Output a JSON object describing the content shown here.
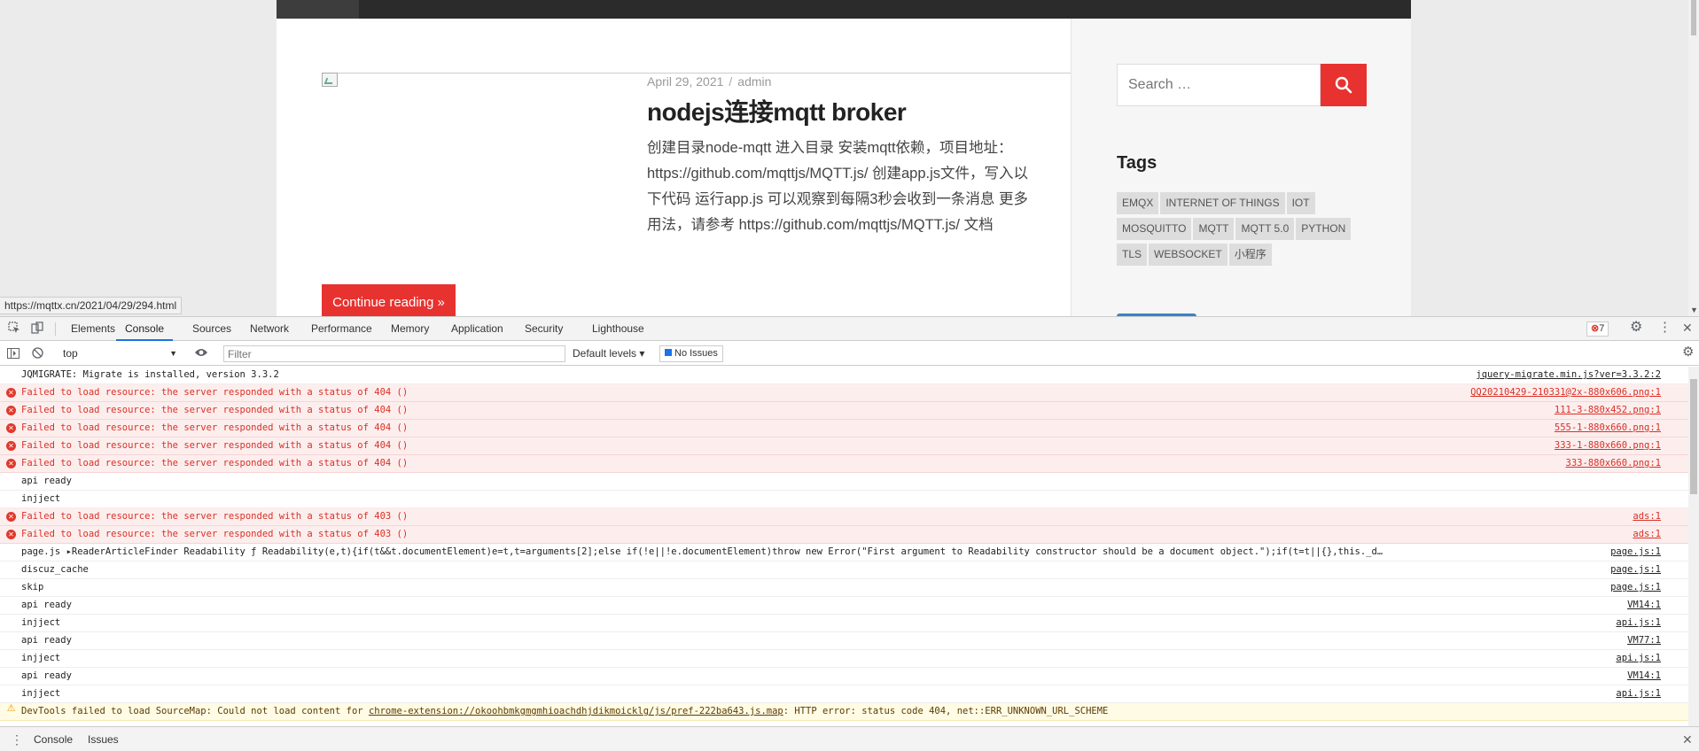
{
  "page": {
    "post": {
      "date": "April 29, 2021",
      "separator": "/",
      "author": "admin",
      "title": "nodejs连接mqtt broker",
      "excerpt": "创建目录node-mqtt 进入目录 安装mqtt依赖，项目地址：https://github.com/mqttjs/MQTT.js/ 创建app.js文件，写入以下代码 运行app.js 可以观察到每隔3秒会收到一条消息 更多用法，请参考 https://github.com/mqttjs/MQTT.js/ 文档",
      "continue_label": "Continue reading »"
    },
    "sidebar": {
      "search_placeholder": "Search …",
      "tags_title": "Tags",
      "tags": [
        "EMQX",
        "INTERNET OF THINGS",
        "IOT",
        "MOSQUITTO",
        "MQTT",
        "MQTT 5.0",
        "PYTHON",
        "TLS",
        "WEBSOCKET",
        "小程序"
      ]
    },
    "status_url": "https://mqttx.cn/2021/04/29/294.html"
  },
  "devtools": {
    "tabs": [
      "Elements",
      "Console",
      "Sources",
      "Network",
      "Performance",
      "Memory",
      "Application",
      "Security",
      "Lighthouse"
    ],
    "active_tab": "Console",
    "error_count": "7",
    "context": "top",
    "filter_placeholder": "Filter",
    "levels": "Default levels ▾",
    "issues": "No Issues",
    "messages": [
      {
        "level": "log",
        "text": "JQMIGRATE: Migrate is installed, version 3.3.2",
        "source": "jquery-migrate.min.js?ver=3.3.2:2"
      },
      {
        "level": "error",
        "text": "Failed to load resource: the server responded with a status of 404 ()",
        "source": "QQ20210429-210331@2x-880x606.png:1"
      },
      {
        "level": "error",
        "text": "Failed to load resource: the server responded with a status of 404 ()",
        "source": "111-3-880x452.png:1"
      },
      {
        "level": "error",
        "text": "Failed to load resource: the server responded with a status of 404 ()",
        "source": "555-1-880x660.png:1"
      },
      {
        "level": "error",
        "text": "Failed to load resource: the server responded with a status of 404 ()",
        "source": "333-1-880x660.png:1"
      },
      {
        "level": "error",
        "text": "Failed to load resource: the server responded with a status of 404 ()",
        "source": "333-880x660.png:1"
      },
      {
        "level": "log",
        "text": "api ready",
        "source": ""
      },
      {
        "level": "log",
        "text": "injject",
        "source": ""
      },
      {
        "level": "error",
        "text": "Failed to load resource: the server responded with a status of 403 ()",
        "source": "ads:1"
      },
      {
        "level": "error",
        "text": "Failed to load resource: the server responded with a status of 403 ()",
        "source": "ads:1"
      },
      {
        "level": "log",
        "text": "page.js ▸ReaderArticleFinder Readability ƒ Readability(e,t){if(t&&t.documentElement)e=t,t=arguments[2];else if(!e||!e.documentElement)throw new Error(\"First argument to Readability constructor should be a document object.\");if(t=t||{},this._d…",
        "source": "page.js:1"
      },
      {
        "level": "log",
        "text": "discuz_cache",
        "source": "page.js:1"
      },
      {
        "level": "log",
        "text": "skip",
        "source": "page.js:1"
      },
      {
        "level": "log",
        "text": "api ready",
        "source": "VM14:1"
      },
      {
        "level": "log",
        "text": "injject",
        "source": "api.js:1"
      },
      {
        "level": "log",
        "text": "api ready",
        "source": "VM77:1"
      },
      {
        "level": "log",
        "text": "injject",
        "source": "api.js:1"
      },
      {
        "level": "log",
        "text": "api ready",
        "source": "VM14:1"
      },
      {
        "level": "log",
        "text": "injject",
        "source": "api.js:1"
      }
    ],
    "warning": {
      "prefix": "DevTools failed to load SourceMap: Could not load content for ",
      "link": "chrome-extension://okoohbmkgmgmhioachdhjdikmoicklg/js/pref-222ba643.js.map",
      "suffix": ": HTTP error: status code 404, net::ERR_UNKNOWN_URL_SCHEME"
    },
    "drawer_tabs": [
      "Console",
      "Issues"
    ]
  }
}
